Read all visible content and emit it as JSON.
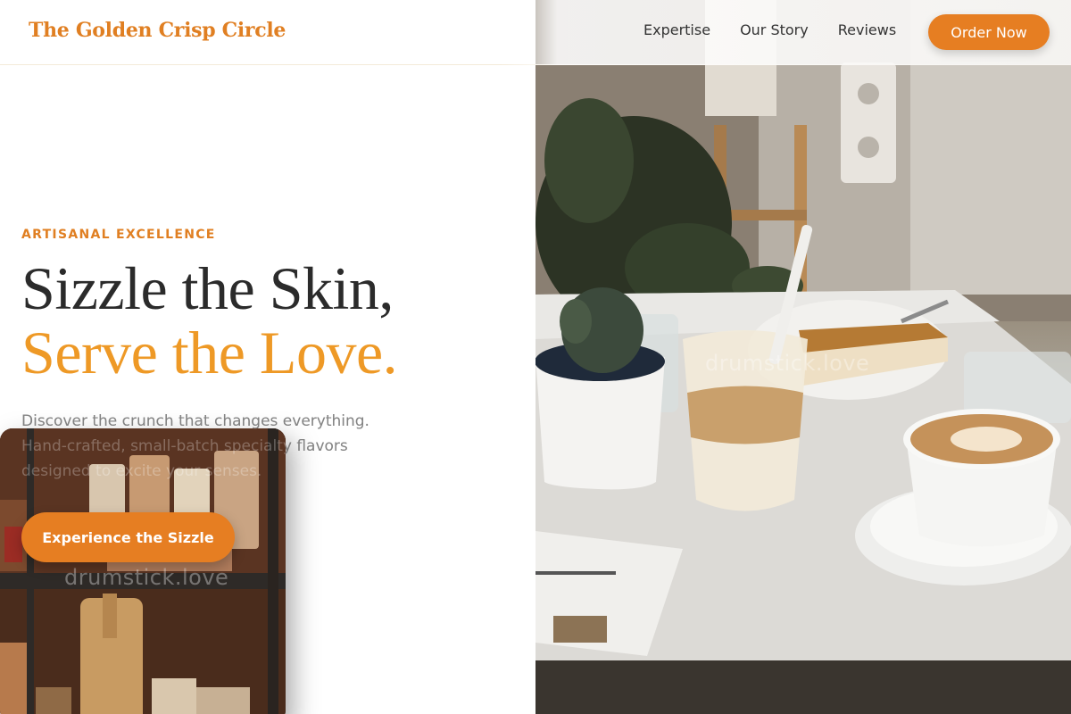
{
  "brand": {
    "name": "The Golden Crisp Circle"
  },
  "nav": {
    "items": [
      "Expertise",
      "Our Story",
      "Reviews"
    ],
    "cta_label": "Order Now"
  },
  "hero": {
    "eyebrow": "ARTISANAL EXCELLENCE",
    "headline_line1": "Sizzle the Skin,",
    "headline_line2": "Serve the Love.",
    "lede": "Discover the crunch that changes everything. Hand-crafted, small-batch specialty flavors designed to excite your senses.",
    "cta_label": "Experience the Sizzle"
  },
  "watermarks": [
    "drumstick.love",
    "drumstick.love"
  ],
  "colors": {
    "accent": "#e67e22",
    "accent_light": "#ee9926",
    "text_dark": "#2b2b2b",
    "text_muted": "#555555"
  }
}
